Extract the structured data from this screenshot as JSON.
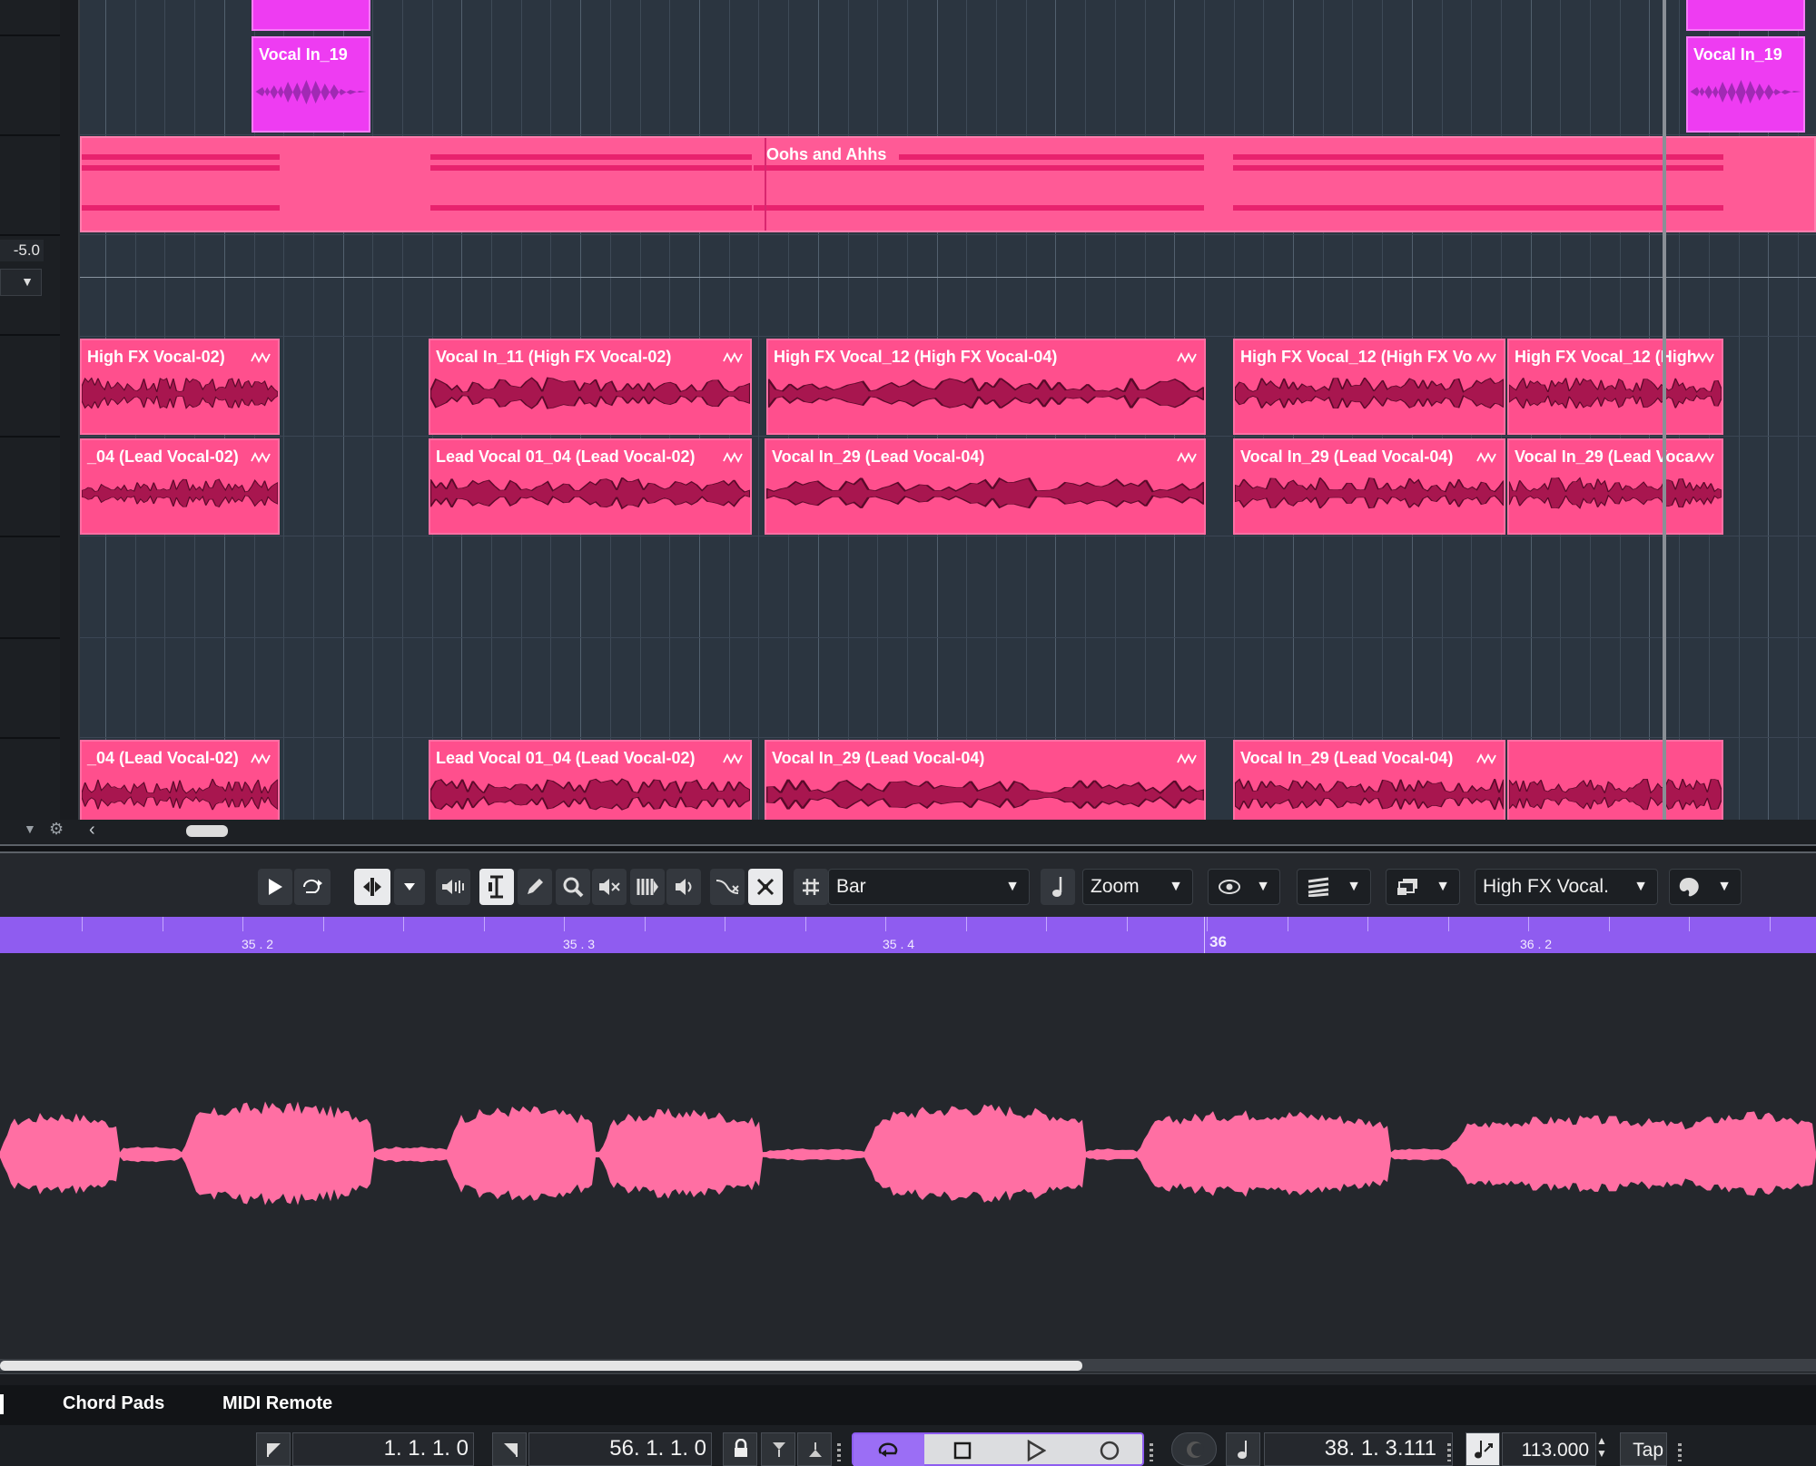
{
  "track_header": {
    "volume_value": "-5.0"
  },
  "project": {
    "events": [
      {
        "id": "vocal-in-19-a",
        "title": "Vocal In_19",
        "color": "magenta"
      },
      {
        "id": "vocal-in-19-b",
        "title": "Vocal In_19",
        "color": "magenta"
      },
      {
        "id": "oohs-and-ahhs",
        "title": "Oohs and Ahhs",
        "color": "pink"
      },
      {
        "id": "r1-e1",
        "title": "High FX Vocal-02)"
      },
      {
        "id": "r1-e2",
        "title": "Vocal In_11 (High FX Vocal-02)"
      },
      {
        "id": "r1-e3",
        "title": "High FX Vocal_12 (High FX Vocal-04)"
      },
      {
        "id": "r1-e4",
        "title": "High FX Vocal_12 (High FX Vo"
      },
      {
        "id": "r1-e5",
        "title": "High FX Vocal_12 (High"
      },
      {
        "id": "r2-e1",
        "title": "_04 (Lead Vocal-02)"
      },
      {
        "id": "r2-e2",
        "title": "Lead Vocal 01_04 (Lead Vocal-02)"
      },
      {
        "id": "r2-e3",
        "title": "Vocal In_29 (Lead Vocal-04)"
      },
      {
        "id": "r2-e4",
        "title": "Vocal In_29 (Lead Vocal-04)"
      },
      {
        "id": "r2-e5",
        "title": "Vocal In_29 (Lead Voca"
      },
      {
        "id": "r3-e1",
        "title": "_04 (Lead Vocal-02)"
      },
      {
        "id": "r3-e2",
        "title": "Lead Vocal 01_04 (Lead Vocal-02)"
      },
      {
        "id": "r3-e3",
        "title": "Vocal In_29 (Lead Vocal-04)"
      },
      {
        "id": "r3-e4",
        "title": "Vocal In_29 (Lead Vocal-04)"
      }
    ],
    "scroll_left_glyph": "‹"
  },
  "editor_toolbar": {
    "snap_type": "Bar",
    "zoom_mode": "Zoom",
    "track_select": "High FX Vocal."
  },
  "editor_ruler": {
    "labels": [
      "35 . 2",
      "35 . 3",
      "35 . 4",
      "36",
      "36 . 2"
    ]
  },
  "bottom_tabs": {
    "chord_pads": "Chord Pads",
    "midi_remote": "MIDI Remote"
  },
  "transport": {
    "left_locator": "1.  1.  1.    0",
    "right_locator": "56.  1.  1.    0",
    "position": "38.  1.  3.111",
    "tempo": "113.000",
    "tap_label": "Tap"
  },
  "colors": {
    "event_pink": "#ff4f8d",
    "event_magenta": "#ee3cf2",
    "editor_wave": "#ff6fa3",
    "ruler_purple": "#8f5cf0"
  }
}
